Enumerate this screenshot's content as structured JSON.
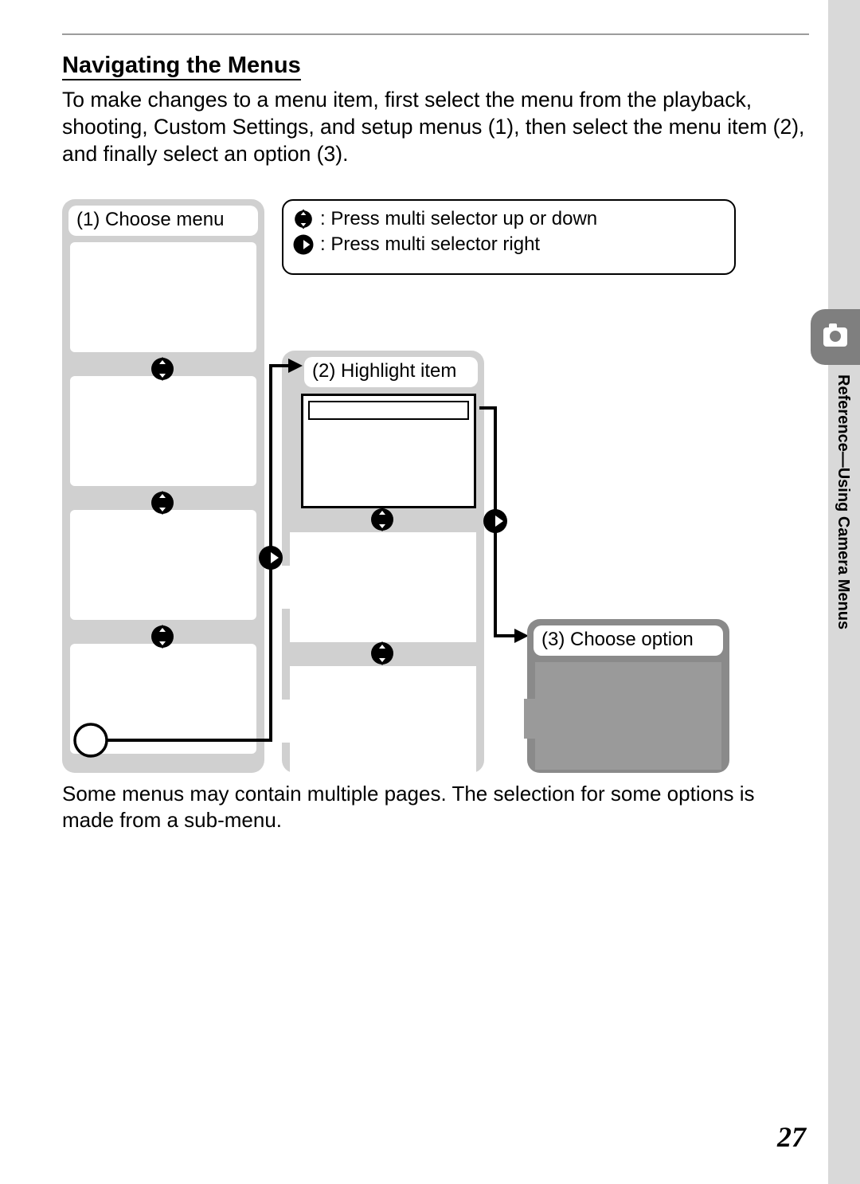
{
  "heading": "Navigating the Menus",
  "intro": "To make changes to a menu item, first select the menu from the playback, shooting, Custom Settings, and setup menus (1), then select the menu item (2), and finally select an option (3).",
  "panel1_caption": "(1) Choose menu",
  "panel2_caption": "(2) Highlight item",
  "panel3_caption": "(3) Choose option",
  "legend_updown": ": Press multi selector up or down",
  "legend_right": ": Press multi selector right",
  "footer": "Some menus may contain multiple pages.  The selection for some options is made from a sub-menu.",
  "side_label": "Reference—Using Camera Menus",
  "page_number": "27"
}
